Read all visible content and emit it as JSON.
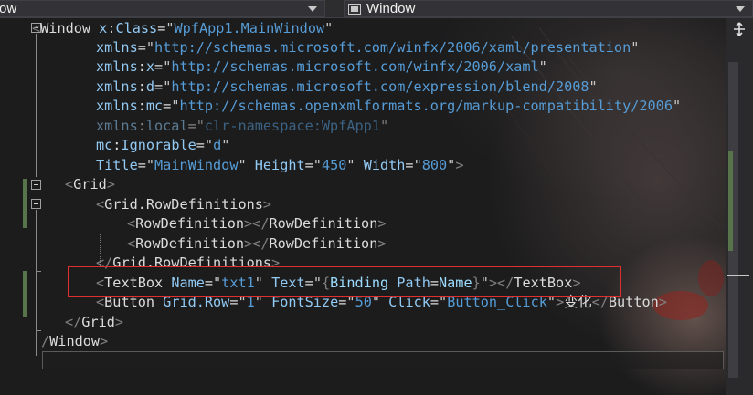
{
  "navigation_bar": {
    "left_dropdown": "ow",
    "right_dropdown": "Window"
  },
  "code_lines": [
    [
      [
        "t-br",
        "<"
      ],
      [
        "t-name",
        "Window "
      ],
      [
        "t-attr",
        "x"
      ],
      [
        "t-eq",
        ":"
      ],
      [
        "t-attr",
        "Class"
      ],
      [
        "t-eq",
        "="
      ],
      [
        "t-str",
        "\""
      ],
      [
        "t-val",
        "WpfApp1.MainWindow"
      ],
      [
        "t-str",
        "\""
      ]
    ],
    [
      [
        "t-attr",
        "xmlns"
      ],
      [
        "t-eq",
        "="
      ],
      [
        "t-str",
        "\""
      ],
      [
        "t-val",
        "http://schemas.microsoft.com/winfx/2006/xaml/presentation"
      ],
      [
        "t-str",
        "\""
      ]
    ],
    [
      [
        "t-attr",
        "xmlns"
      ],
      [
        "t-eq",
        ":"
      ],
      [
        "t-attr",
        "x"
      ],
      [
        "t-eq",
        "="
      ],
      [
        "t-str",
        "\""
      ],
      [
        "t-val",
        "http://schemas.microsoft.com/winfx/2006/xaml"
      ],
      [
        "t-str",
        "\""
      ]
    ],
    [
      [
        "t-attr",
        "xmlns"
      ],
      [
        "t-eq",
        ":"
      ],
      [
        "t-attr",
        "d"
      ],
      [
        "t-eq",
        "="
      ],
      [
        "t-str",
        "\""
      ],
      [
        "t-val",
        "http://schemas.microsoft.com/expression/blend/2008"
      ],
      [
        "t-str",
        "\""
      ]
    ],
    [
      [
        "t-attr",
        "xmlns"
      ],
      [
        "t-eq",
        ":"
      ],
      [
        "t-attr",
        "mc"
      ],
      [
        "t-eq",
        "="
      ],
      [
        "t-str",
        "\""
      ],
      [
        "t-val",
        "http://schemas.openxmlformats.org/markup-compatibility/2006"
      ],
      [
        "t-str",
        "\""
      ]
    ],
    [
      [
        "t-attr dim",
        "xmlns"
      ],
      [
        "t-eq dim",
        ":"
      ],
      [
        "t-attr dim",
        "local"
      ],
      [
        "t-eq dim",
        "="
      ],
      [
        "t-str dim",
        "\""
      ],
      [
        "t-val dim",
        "clr-namespace:WpfApp1"
      ],
      [
        "t-str dim",
        "\""
      ]
    ],
    [
      [
        "t-attr",
        "mc"
      ],
      [
        "t-eq",
        ":"
      ],
      [
        "t-attr",
        "Ignorable"
      ],
      [
        "t-eq",
        "="
      ],
      [
        "t-str",
        "\""
      ],
      [
        "t-val",
        "d"
      ],
      [
        "t-str",
        "\""
      ]
    ],
    [
      [
        "t-attr",
        "Title"
      ],
      [
        "t-eq",
        "="
      ],
      [
        "t-str",
        "\""
      ],
      [
        "t-val",
        "MainWindow"
      ],
      [
        "t-str",
        "\" "
      ],
      [
        "t-attr",
        "Height"
      ],
      [
        "t-eq",
        "="
      ],
      [
        "t-str",
        "\""
      ],
      [
        "t-val",
        "450"
      ],
      [
        "t-str",
        "\" "
      ],
      [
        "t-attr",
        "Width"
      ],
      [
        "t-eq",
        "="
      ],
      [
        "t-str",
        "\""
      ],
      [
        "t-val",
        "800"
      ],
      [
        "t-str",
        "\""
      ],
      [
        "t-br",
        ">"
      ]
    ],
    [
      [
        "t-br",
        "<"
      ],
      [
        "t-name",
        "Grid"
      ],
      [
        "t-br",
        ">"
      ]
    ],
    [
      [
        "t-br",
        "<"
      ],
      [
        "t-name",
        "Grid.RowDefinitions"
      ],
      [
        "t-br",
        ">"
      ]
    ],
    [
      [
        "t-br",
        "<"
      ],
      [
        "t-name",
        "RowDefinition"
      ],
      [
        "t-br",
        "></"
      ],
      [
        "t-name",
        "RowDefinition"
      ],
      [
        "t-br",
        ">"
      ]
    ],
    [
      [
        "t-br",
        "<"
      ],
      [
        "t-name",
        "RowDefinition"
      ],
      [
        "t-br",
        "></"
      ],
      [
        "t-name",
        "RowDefinition"
      ],
      [
        "t-br",
        ">"
      ]
    ],
    [
      [
        "t-br",
        "</"
      ],
      [
        "t-name",
        "Grid.RowDefinitions"
      ],
      [
        "t-br",
        ">"
      ]
    ],
    [
      [
        "t-br",
        "<"
      ],
      [
        "t-name",
        "TextBox "
      ],
      [
        "t-attr",
        "Name"
      ],
      [
        "t-eq",
        "="
      ],
      [
        "t-str",
        "\""
      ],
      [
        "t-val",
        "txt1"
      ],
      [
        "t-str",
        "\" "
      ],
      [
        "t-attr",
        "Text"
      ],
      [
        "t-eq",
        "="
      ],
      [
        "t-str",
        "\""
      ],
      [
        "t-br",
        "{"
      ],
      [
        "t-ext",
        "Binding "
      ],
      [
        "t-attr",
        "Path"
      ],
      [
        "t-eq",
        "="
      ],
      [
        "t-ext",
        "Name"
      ],
      [
        "t-br",
        "}"
      ],
      [
        "t-str",
        "\""
      ],
      [
        "t-br",
        "></"
      ],
      [
        "t-name",
        "TextBox"
      ],
      [
        "t-br",
        ">"
      ]
    ],
    [
      [
        "t-br",
        "<"
      ],
      [
        "t-name",
        "Button "
      ],
      [
        "t-attr",
        "Grid.Row"
      ],
      [
        "t-eq",
        "="
      ],
      [
        "t-str",
        "\""
      ],
      [
        "t-val",
        "1"
      ],
      [
        "t-str",
        "\" "
      ],
      [
        "t-attr",
        "FontSize"
      ],
      [
        "t-eq",
        "="
      ],
      [
        "t-str",
        "\""
      ],
      [
        "t-val",
        "50"
      ],
      [
        "t-str",
        "\" "
      ],
      [
        "t-attr",
        "Click"
      ],
      [
        "t-eq",
        "="
      ],
      [
        "t-str",
        "\""
      ],
      [
        "t-val",
        "Button_Click"
      ],
      [
        "t-str",
        "\""
      ],
      [
        "t-br",
        ">"
      ],
      [
        "t-text",
        "变化"
      ],
      [
        "t-br",
        "</"
      ],
      [
        "t-name",
        "Button"
      ],
      [
        "t-br",
        ">"
      ]
    ],
    [
      [
        "t-br",
        "</"
      ],
      [
        "t-name",
        "Grid"
      ],
      [
        "t-br",
        ">"
      ]
    ],
    [
      [
        "t-br",
        "/"
      ],
      [
        "t-name",
        "Window"
      ],
      [
        "t-br",
        ">"
      ]
    ]
  ]
}
